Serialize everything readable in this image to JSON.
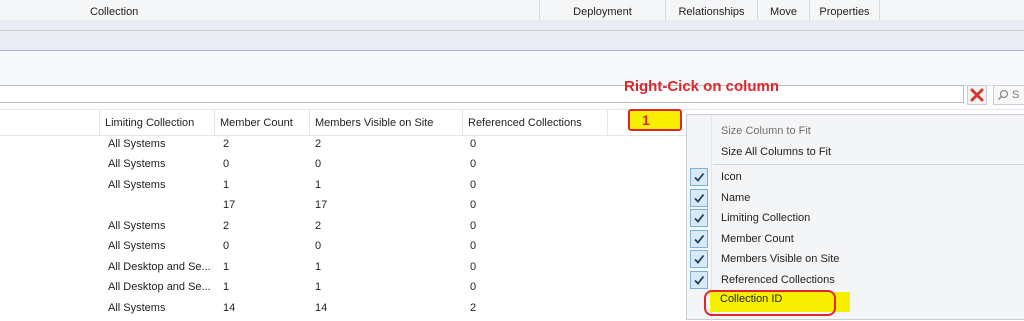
{
  "ribbon": {
    "groups": [
      "Collection",
      "Deployment",
      "Relationships",
      "Move",
      "Properties"
    ]
  },
  "search": {
    "value": "",
    "search_label": "S"
  },
  "grid": {
    "columns": [
      "Limiting Collection",
      "Member Count",
      "Members Visible on Site",
      "Referenced Collections"
    ],
    "rows": [
      {
        "limiting": "All Systems",
        "count": "2",
        "visible": "2",
        "refs": "0"
      },
      {
        "limiting": "All Systems",
        "count": "0",
        "visible": "0",
        "refs": "0"
      },
      {
        "limiting": "All Systems",
        "count": "1",
        "visible": "1",
        "refs": "0"
      },
      {
        "limiting": "",
        "count": "17",
        "visible": "17",
        "refs": "0"
      },
      {
        "limiting": "All Systems",
        "count": "2",
        "visible": "2",
        "refs": "0"
      },
      {
        "limiting": "All Systems",
        "count": "0",
        "visible": "0",
        "refs": "0"
      },
      {
        "limiting": "All Desktop and Se...",
        "count": "1",
        "visible": "1",
        "refs": "0"
      },
      {
        "limiting": "All Desktop and Se...",
        "count": "1",
        "visible": "1",
        "refs": "0"
      },
      {
        "limiting": "All Systems",
        "count": "14",
        "visible": "14",
        "refs": "2"
      }
    ]
  },
  "annotation": {
    "title": "Right-Cick on column",
    "step": "1"
  },
  "context_menu": {
    "size_items": [
      {
        "label": "Size Column to Fit",
        "enabled": false
      },
      {
        "label": "Size All Columns to Fit",
        "enabled": true
      }
    ],
    "column_items": [
      {
        "label": "Icon",
        "checked": true
      },
      {
        "label": "Name",
        "checked": true
      },
      {
        "label": "Limiting Collection",
        "checked": true
      },
      {
        "label": "Member Count",
        "checked": true
      },
      {
        "label": "Members Visible on Site",
        "checked": true
      },
      {
        "label": "Referenced Collections",
        "checked": true
      },
      {
        "label": "Collection ID",
        "checked": false
      }
    ]
  },
  "colors": {
    "annotation_red": "#e0262a",
    "highlight_yellow": "#f6f000"
  }
}
